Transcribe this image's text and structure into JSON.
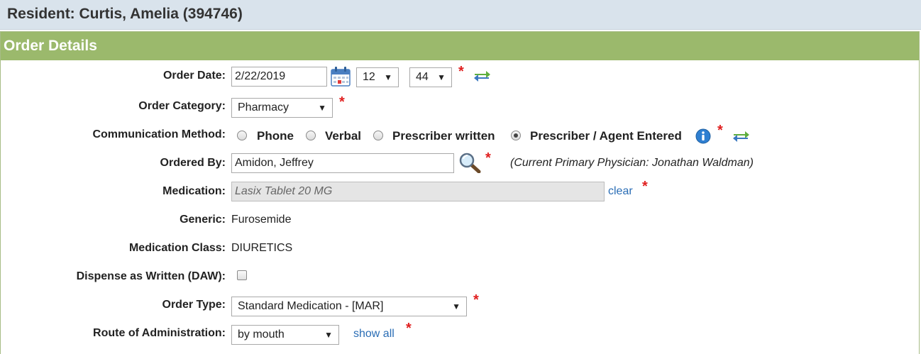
{
  "resident": {
    "title": "Resident: Curtis, Amelia (394746)"
  },
  "panel": {
    "title": "Order Details"
  },
  "form": {
    "order_date": {
      "label": "Order Date:",
      "value": "2/22/2019",
      "hour": "12",
      "minute": "44"
    },
    "order_category": {
      "label": "Order Category:",
      "value": "Pharmacy"
    },
    "communication_method": {
      "label": "Communication Method:",
      "options": [
        "Phone",
        "Verbal",
        "Prescriber written",
        "Prescriber / Agent Entered"
      ],
      "selected": "Prescriber / Agent Entered"
    },
    "ordered_by": {
      "label": "Ordered By:",
      "value": "Amidon, Jeffrey",
      "note": "(Current Primary Physician:  Jonathan Waldman)"
    },
    "medication": {
      "label": "Medication:",
      "placeholder": "Lasix Tablet 20 MG",
      "clear_label": "clear"
    },
    "generic": {
      "label": "Generic:",
      "value": "Furosemide"
    },
    "medication_class": {
      "label": "Medication Class:",
      "value": "DIURETICS"
    },
    "daw": {
      "label": "Dispense as Written (DAW):",
      "checked": false
    },
    "order_type": {
      "label": "Order Type:",
      "value": "Standard Medication - [MAR]"
    },
    "route": {
      "label": "Route of Administration:",
      "value": "by mouth",
      "show_all_label": "show all"
    }
  },
  "required_marker": "*",
  "dropdown_arrow": "▼",
  "icons": [
    "calendar-icon",
    "swap-arrows-icon",
    "magnifier-icon",
    "info-icon"
  ],
  "colors": {
    "header_green": "#9bb96c",
    "resident_bar": "#d9e3ec",
    "link_blue": "#2a6db5",
    "required_red": "#e01f1f"
  }
}
